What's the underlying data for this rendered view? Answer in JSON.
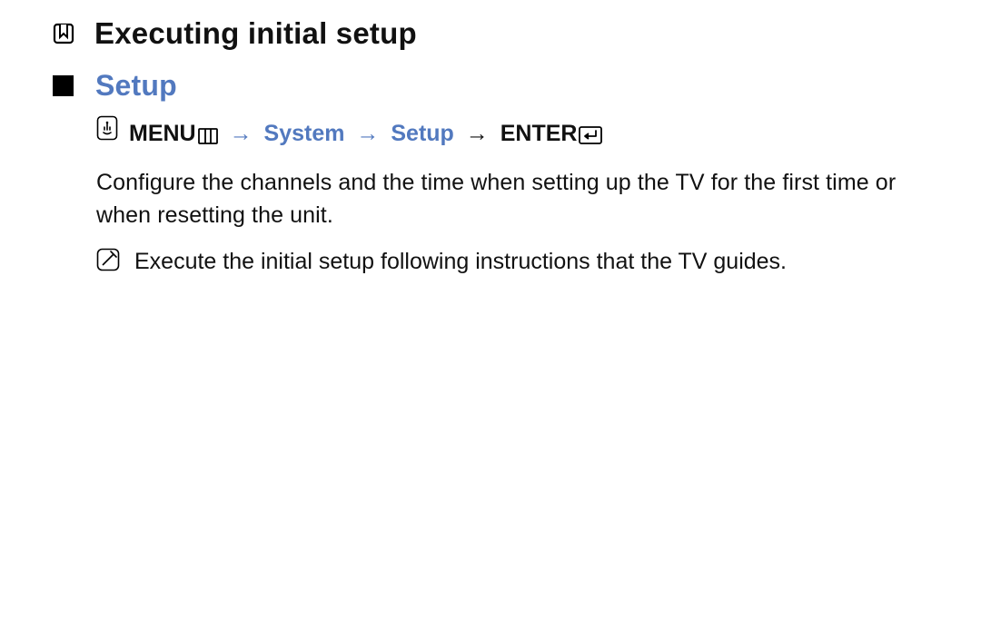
{
  "heading": "Executing initial setup",
  "section_title": "Setup",
  "nav": {
    "menu_label": "MENU",
    "system": "System",
    "setup": "Setup",
    "enter_label": "ENTER",
    "arrow": "→"
  },
  "para": "Configure the channels and the time when setting up the TV for the first time or when resetting the unit.",
  "note": "Execute the initial setup following instructions that the TV guides."
}
